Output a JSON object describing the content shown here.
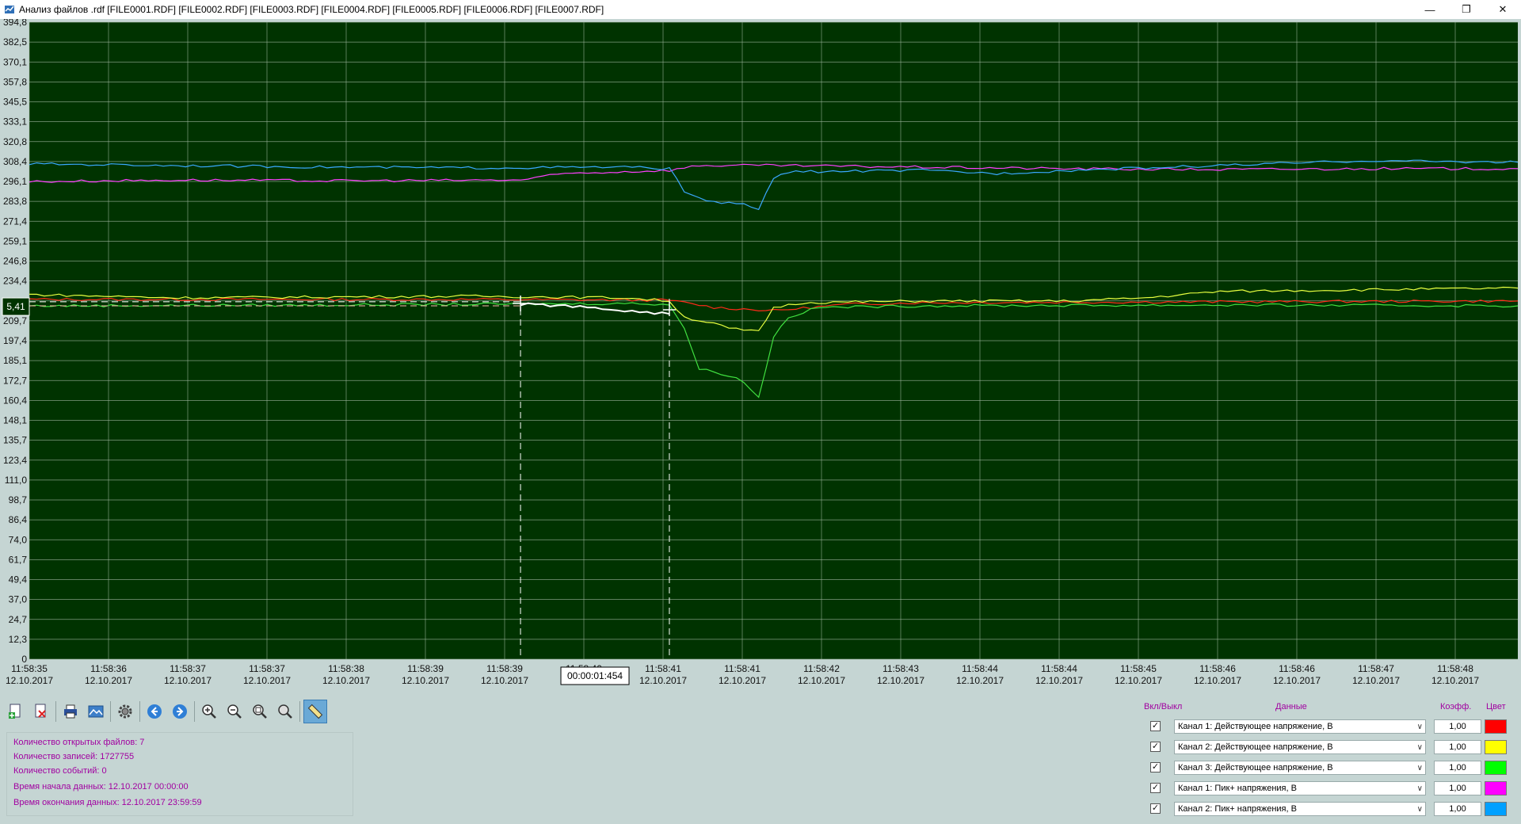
{
  "window": {
    "title": "Анализ файлов .rdf [FILE0001.RDF] [FILE0002.RDF] [FILE0003.RDF] [FILE0004.RDF] [FILE0005.RDF] [FILE0006.RDF] [FILE0007.RDF]",
    "icons": [
      "minimize-icon",
      "restore-icon",
      "close-icon"
    ]
  },
  "chart_data": {
    "type": "line",
    "background": "#003300",
    "grid": true,
    "y_ticks": [
      "394,8",
      "382,5",
      "370,1",
      "357,8",
      "345,5",
      "333,1",
      "320,8",
      "308,4",
      "296,1",
      "283,8",
      "271,4",
      "259,1",
      "246,8",
      "234,4",
      "222,1",
      "209,7",
      "197,4",
      "185,1",
      "172,7",
      "160,4",
      "148,1",
      "135,7",
      "123,4",
      "111,0",
      "98,7",
      "86,4",
      "74,0",
      "61,7",
      "49,4",
      "37,0",
      "24,7",
      "12,3",
      "0"
    ],
    "ylim": [
      0,
      394.8
    ],
    "x_ticks": [
      {
        "time": "11:58:35",
        "date": "12.10.2017"
      },
      {
        "time": "11:58:36",
        "date": "12.10.2017"
      },
      {
        "time": "11:58:37",
        "date": "12.10.2017"
      },
      {
        "time": "11:58:37",
        "date": "12.10.2017"
      },
      {
        "time": "11:58:38",
        "date": "12.10.2017"
      },
      {
        "time": "11:58:39",
        "date": "12.10.2017"
      },
      {
        "time": "11:58:39",
        "date": "12.10.2017"
      },
      {
        "time": "11:58:40",
        "date": "12.10.2017"
      },
      {
        "time": "11:58:41",
        "date": "12.10.2017"
      },
      {
        "time": "11:58:41",
        "date": "12.10.2017"
      },
      {
        "time": "11:58:42",
        "date": "12.10.2017"
      },
      {
        "time": "11:58:43",
        "date": "12.10.2017"
      },
      {
        "time": "11:58:44",
        "date": "12.10.2017"
      },
      {
        "time": "11:58:44",
        "date": "12.10.2017"
      },
      {
        "time": "11:58:45",
        "date": "12.10.2017"
      },
      {
        "time": "11:58:46",
        "date": "12.10.2017"
      },
      {
        "time": "11:58:46",
        "date": "12.10.2017"
      },
      {
        "time": "11:58:47",
        "date": "12.10.2017"
      },
      {
        "time": "11:58:48",
        "date": "12.10.2017"
      }
    ],
    "cursor_value_label": "5,41",
    "cursor_time_label": "00:00:01:454",
    "series": [
      {
        "name": "Канал 1: Действующее напряжение, В",
        "color": "#ff2a1a",
        "points": [
          [
            0,
            223
          ],
          [
            0.3,
            223
          ],
          [
            0.43,
            222.5
          ],
          [
            0.46,
            218
          ],
          [
            0.5,
            216
          ],
          [
            0.55,
            220
          ],
          [
            0.6,
            221
          ],
          [
            0.8,
            221.5
          ],
          [
            1,
            222
          ]
        ]
      },
      {
        "name": "Канал 2: Действующее напряжение, В",
        "color": "#e8ff40",
        "points": [
          [
            0,
            226
          ],
          [
            0.05,
            225
          ],
          [
            0.1,
            224
          ],
          [
            0.2,
            224.5
          ],
          [
            0.3,
            225
          ],
          [
            0.4,
            224
          ],
          [
            0.43,
            222
          ],
          [
            0.44,
            212
          ],
          [
            0.46,
            208
          ],
          [
            0.47,
            205
          ],
          [
            0.49,
            203
          ],
          [
            0.5,
            218
          ],
          [
            0.52,
            221
          ],
          [
            0.6,
            222
          ],
          [
            0.7,
            222
          ],
          [
            0.75,
            224
          ],
          [
            0.8,
            228
          ],
          [
            0.9,
            229
          ],
          [
            1,
            230
          ]
        ]
      },
      {
        "name": "Канал 3: Действующее напряжение, В",
        "color": "#40e040",
        "points": [
          [
            0,
            219
          ],
          [
            0.2,
            219.5
          ],
          [
            0.3,
            220
          ],
          [
            0.4,
            220.5
          ],
          [
            0.43,
            220
          ],
          [
            0.44,
            205
          ],
          [
            0.45,
            180
          ],
          [
            0.46,
            178
          ],
          [
            0.47,
            176
          ],
          [
            0.48,
            172
          ],
          [
            0.49,
            162
          ],
          [
            0.5,
            200
          ],
          [
            0.51,
            212
          ],
          [
            0.53,
            218
          ],
          [
            0.6,
            219
          ],
          [
            0.8,
            219.5
          ],
          [
            1,
            219
          ]
        ]
      },
      {
        "name": "Канал 1: Пик+ напряжения, В",
        "color": "#ff40ff",
        "points": [
          [
            0,
            296
          ],
          [
            0.1,
            297
          ],
          [
            0.2,
            296.5
          ],
          [
            0.33,
            297
          ],
          [
            0.36,
            301
          ],
          [
            0.43,
            303
          ],
          [
            0.45,
            306
          ],
          [
            0.5,
            306
          ],
          [
            0.6,
            305
          ],
          [
            0.7,
            304
          ],
          [
            0.8,
            303.5
          ],
          [
            0.9,
            304
          ],
          [
            1,
            304
          ]
        ]
      },
      {
        "name": "Канал 2: Пик+ напряжения, В",
        "color": "#3aa8ff",
        "points": [
          [
            0,
            307
          ],
          [
            0.1,
            306
          ],
          [
            0.2,
            305
          ],
          [
            0.3,
            304.5
          ],
          [
            0.4,
            305
          ],
          [
            0.43,
            304
          ],
          [
            0.44,
            290
          ],
          [
            0.46,
            283
          ],
          [
            0.48,
            282
          ],
          [
            0.49,
            279
          ],
          [
            0.5,
            298
          ],
          [
            0.51,
            302
          ],
          [
            0.6,
            303
          ],
          [
            0.65,
            301
          ],
          [
            0.7,
            303
          ],
          [
            0.8,
            306
          ],
          [
            0.9,
            309
          ],
          [
            1,
            308
          ]
        ]
      },
      {
        "name": "",
        "color": "#ffffff",
        "points": [
          [
            0.33,
            220
          ],
          [
            0.36,
            219
          ],
          [
            0.4,
            216
          ],
          [
            0.43,
            214
          ]
        ]
      }
    ]
  },
  "toolbar": {
    "buttons": [
      {
        "name": "open-files-button",
        "icon": "file-add-icon"
      },
      {
        "name": "close-files-button",
        "icon": "file-delete-icon"
      },
      {
        "name": "print-button",
        "icon": "printer-icon"
      },
      {
        "name": "export-image-button",
        "icon": "image-icon"
      },
      {
        "name": "settings-button",
        "icon": "gear-icon"
      },
      {
        "name": "back-button",
        "icon": "arrow-left-icon"
      },
      {
        "name": "forward-button",
        "icon": "arrow-right-icon"
      },
      {
        "name": "zoom-in-button",
        "icon": "zoom-in-icon"
      },
      {
        "name": "zoom-out-button",
        "icon": "zoom-out-icon"
      },
      {
        "name": "zoom-fit-button",
        "icon": "zoom-fit-icon"
      },
      {
        "name": "zoom-reset-button",
        "icon": "zoom-reset-icon"
      },
      {
        "name": "measure-button",
        "icon": "ruler-icon"
      }
    ]
  },
  "info": {
    "open_files": "Количество открытых файлов: 7",
    "records": "Количество записей: 1727755",
    "events": "Количество событий: 0",
    "start_time": "Время начала данных: 12.10.2017 00:00:00",
    "end_time": "Время окончания данных: 12.10.2017 23:59:59"
  },
  "channels": {
    "headers": {
      "on_off": "Вкл/Выкл",
      "data": "Данные",
      "coef": "Коэфф.",
      "color": "Цвет"
    },
    "rows": [
      {
        "checked": true,
        "label": "Канал 1: Действующее напряжение, В",
        "coef": "1,00",
        "color": "#ff0000"
      },
      {
        "checked": true,
        "label": "Канал 2: Действующее напряжение, В",
        "coef": "1,00",
        "color": "#ffff00"
      },
      {
        "checked": true,
        "label": "Канал 3: Действующее напряжение, В",
        "coef": "1,00",
        "color": "#00ff00"
      },
      {
        "checked": true,
        "label": "Канал 1: Пик+ напряжения, В",
        "coef": "1,00",
        "color": "#ff00ff"
      },
      {
        "checked": true,
        "label": "Канал 2: Пик+ напряжения, В",
        "coef": "1,00",
        "color": "#00a0ff"
      }
    ]
  }
}
